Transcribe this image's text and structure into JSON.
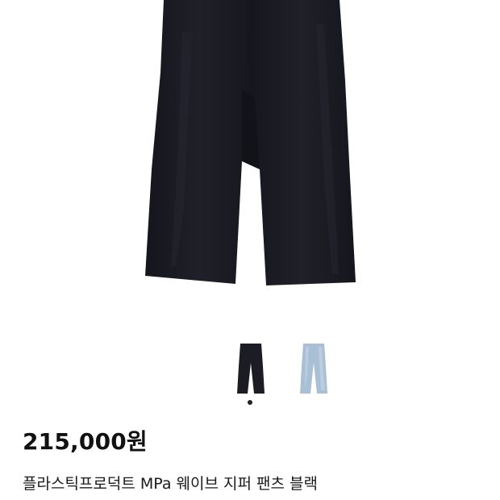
{
  "product": {
    "main_image": "black-wide-pants-photo",
    "thumbnails": [
      {
        "name": "black-pants-thumbnail",
        "color": "#1b1c24"
      },
      {
        "name": "light-blue-pants-thumbnail",
        "color": "#a9bfd3"
      }
    ],
    "price": "215,000원",
    "title": "플라스틱프로덕트 MPa 웨이브 지퍼 팬츠 블랙",
    "subtitle": ""
  },
  "carousel": {
    "current_index": 1,
    "total": 1
  },
  "colors": {
    "pants_black": "#1b1c24",
    "pants_light_blue": "#a9bfd3",
    "indicator": "#222222"
  }
}
